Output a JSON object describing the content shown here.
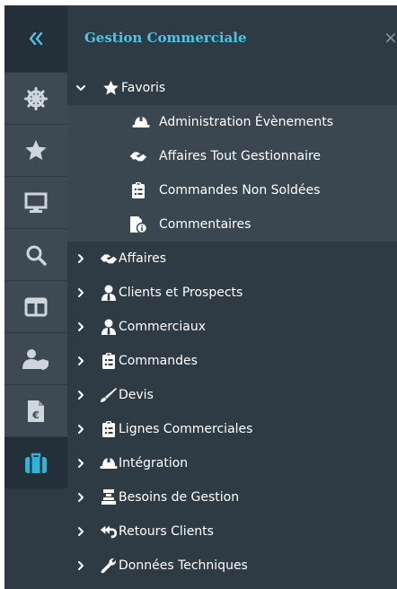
{
  "rail": {
    "collapse_icon": "double-chevron-left-icon",
    "items": [
      {
        "icon": "ship-wheel-icon"
      },
      {
        "icon": "star-icon"
      },
      {
        "icon": "monitor-icon"
      },
      {
        "icon": "search-icon"
      },
      {
        "icon": "columns-icon"
      },
      {
        "icon": "user-shield-icon"
      },
      {
        "icon": "euro-document-icon"
      },
      {
        "icon": "briefcase-icon",
        "active": true
      }
    ]
  },
  "panel": {
    "title": "Gestion Commerciale",
    "close": "×"
  },
  "tree": {
    "favoris": {
      "label": "Favoris",
      "children": [
        {
          "label": "Administration Évènements",
          "icon": "hard-hat-icon"
        },
        {
          "label": "Affaires Tout Gestionnaire",
          "icon": "handshake-icon"
        },
        {
          "label": "Commandes Non Soldées",
          "icon": "clipboard-list-icon"
        },
        {
          "label": "Commentaires",
          "icon": "file-info-icon"
        }
      ]
    },
    "items": [
      {
        "label": "Affaires",
        "icon": "handshake-icon"
      },
      {
        "label": "Clients et Prospects",
        "icon": "user-tie-icon"
      },
      {
        "label": "Commerciaux",
        "icon": "user-tie-icon"
      },
      {
        "label": "Commandes",
        "icon": "clipboard-list-icon"
      },
      {
        "label": "Devis",
        "icon": "pen-icon"
      },
      {
        "label": "Lignes Commerciales",
        "icon": "clipboard-list-icon"
      },
      {
        "label": "Intégration",
        "icon": "hard-hat-icon"
      },
      {
        "label": "Besoins de Gestion",
        "icon": "stacked-layers-icon"
      },
      {
        "label": "Retours Clients",
        "icon": "return-arrow-icon"
      },
      {
        "label": "Données Techniques",
        "icon": "wrench-icon"
      }
    ]
  },
  "colors": {
    "background": "#2e3b45",
    "rail_item": "#3d4a54",
    "rail_active": "#233039",
    "selected_row": "#3a4750",
    "title": "#4fc3e3",
    "accent_icon": "#29b6d9",
    "text": "#ffffff"
  }
}
